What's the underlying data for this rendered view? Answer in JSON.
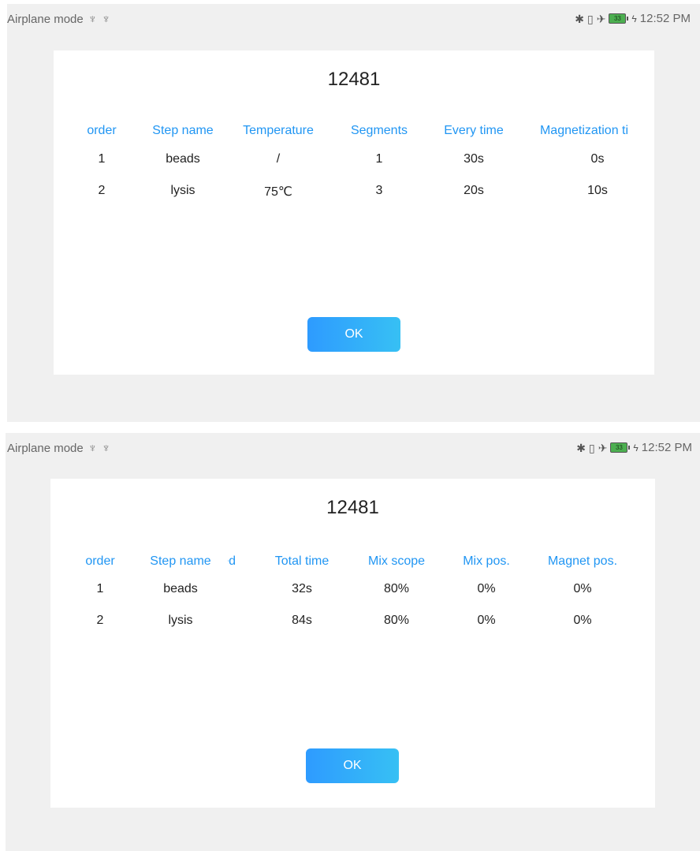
{
  "status_bar": {
    "left_text": "Airplane mode",
    "usb_symbol": "♆",
    "time": "12:52 PM",
    "battery_level": "33",
    "icons": [
      "bluetooth-icon",
      "vibrate-icon",
      "airplane-icon",
      "battery-icon",
      "charging-icon"
    ]
  },
  "dialog1": {
    "title": "12481",
    "headers": [
      "order",
      "Step name",
      "Temperature",
      "Segments",
      "Every time",
      "Magnetization ti"
    ],
    "rows": [
      [
        "1",
        "beads",
        "/",
        "1",
        "30s",
        "0s"
      ],
      [
        "2",
        "lysis",
        "75℃",
        "3",
        "20s",
        "10s"
      ]
    ],
    "ok_label": "OK"
  },
  "dialog2": {
    "title": "12481",
    "headers": [
      "order",
      "Step name",
      "ed",
      "Total time",
      "Mix scope",
      "Mix pos.",
      "Magnet pos."
    ],
    "rows": [
      [
        "1",
        "beads",
        "32s",
        "80%",
        "0%",
        "0%"
      ],
      [
        "2",
        "lysis",
        "84s",
        "80%",
        "0%",
        "0%"
      ]
    ],
    "ok_label": "OK"
  },
  "colors": {
    "accent": "#2196f3",
    "button_start": "#2e9bff",
    "button_end": "#37c0f4",
    "background": "#f0f0f0"
  }
}
